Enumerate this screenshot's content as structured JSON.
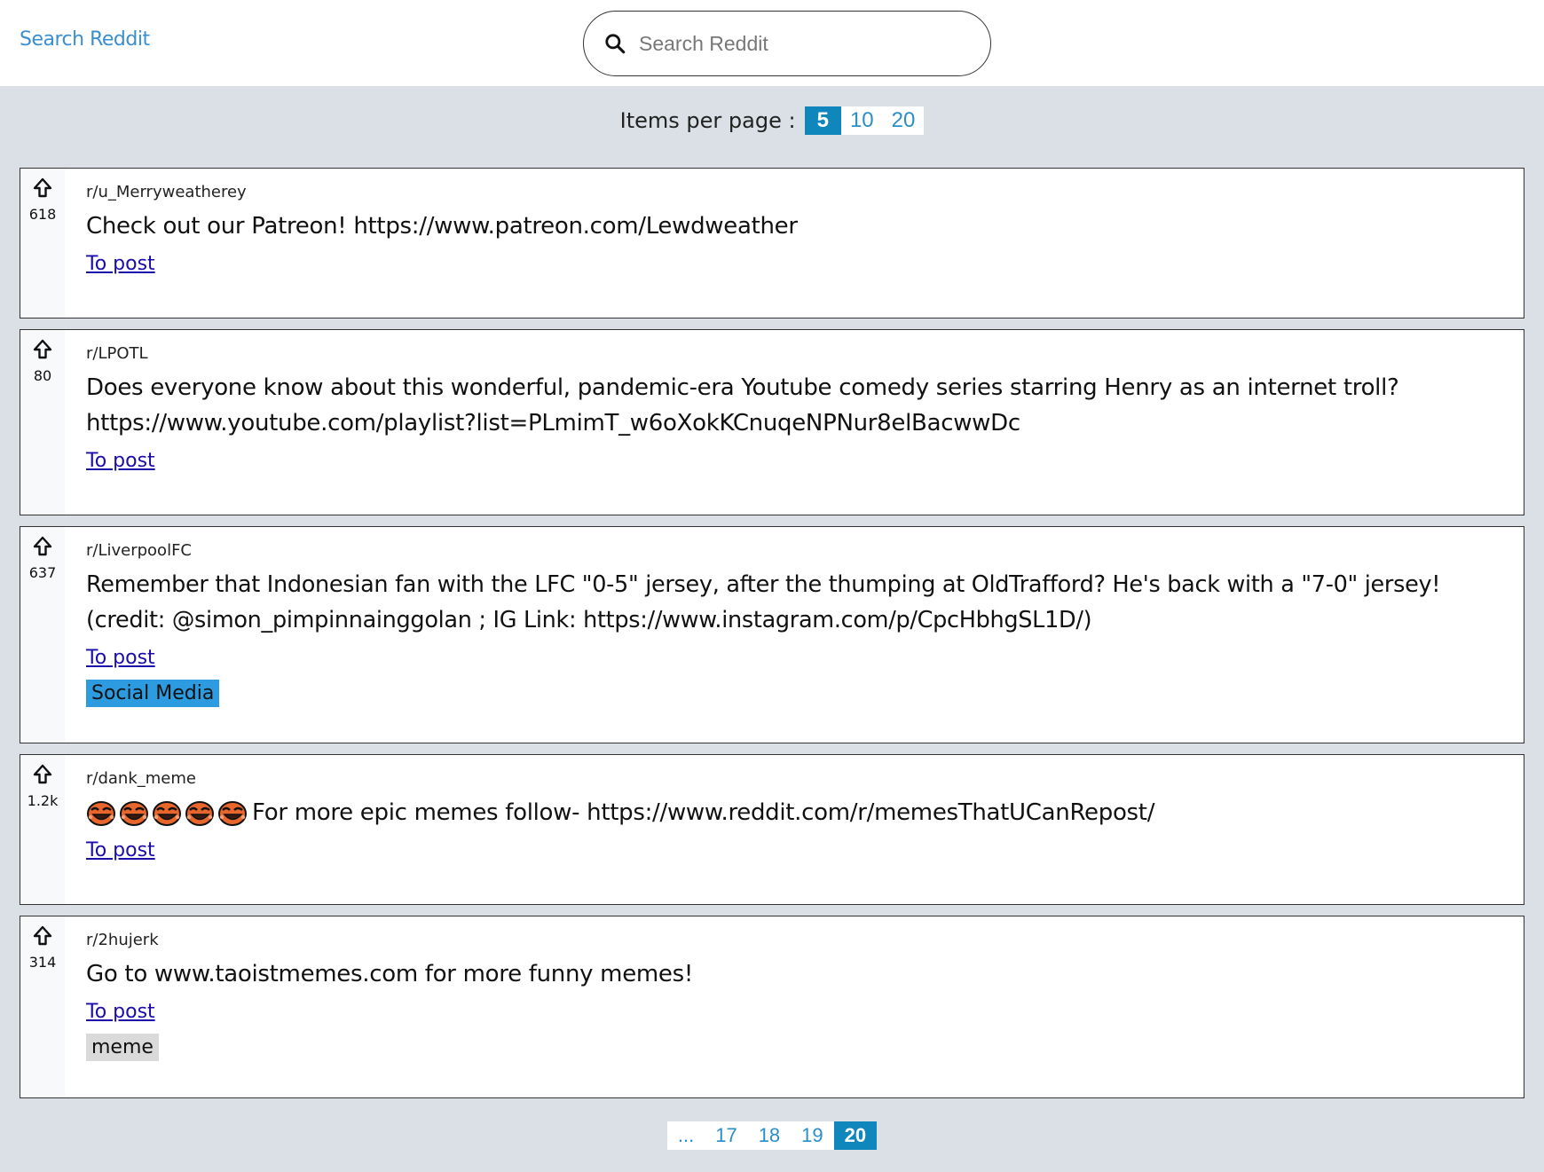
{
  "header": {
    "brand": "Search Reddit",
    "search_placeholder": "Search Reddit"
  },
  "per_page": {
    "label": "Items per page :",
    "options": [
      "5",
      "10",
      "20"
    ],
    "selected": "5"
  },
  "posts": [
    {
      "score": "618",
      "subreddit": "r/u_Merryweatherey",
      "title": "Check out our Patreon! https://www.patreon.com/Lewdweather",
      "link_label": "To post",
      "flair": null
    },
    {
      "score": "80",
      "subreddit": "r/LPOTL",
      "title": "Does everyone know about this wonderful, pandemic-era Youtube comedy series starring Henry as an internet troll? https://www.youtube.com/playlist?list=PLmimT_w6oXokKCnuqeNPNur8elBacwwDc",
      "link_label": "To post",
      "flair": null
    },
    {
      "score": "637",
      "subreddit": "r/LiverpoolFC",
      "title": "Remember that Indonesian fan with the LFC \"0-5\" jersey, after the thumping at OldTrafford? He's back with a \"7-0\" jersey! (credit: @simon_pimpinnainggolan ; IG Link: https://www.instagram.com/p/CpcHbhgSL1D/)",
      "link_label": "To post",
      "flair": {
        "text": "Social Media",
        "bg": "#2d9be0"
      }
    },
    {
      "score": "1.2k",
      "subreddit": "r/dank_meme",
      "title": "For more epic memes follow- https://www.reddit.com/r/memesThatUCanRepost/",
      "emoji_prefix_count": 5,
      "emoji_icon": "laughing-face-emoji-icon",
      "link_label": "To post",
      "flair": null
    },
    {
      "score": "314",
      "subreddit": "r/2hujerk",
      "title": "Go to www.taoistmemes.com for more funny memes!",
      "link_label": "To post",
      "flair": {
        "text": "meme",
        "bg": "#dadada"
      }
    }
  ],
  "pagination": {
    "pages": [
      "...",
      "17",
      "18",
      "19",
      "20"
    ],
    "current": "20"
  },
  "colors": {
    "accent": "#0f87bd",
    "link": "#1a0dab",
    "brand": "#3a8fd2",
    "page_bg": "#dae0e6"
  }
}
